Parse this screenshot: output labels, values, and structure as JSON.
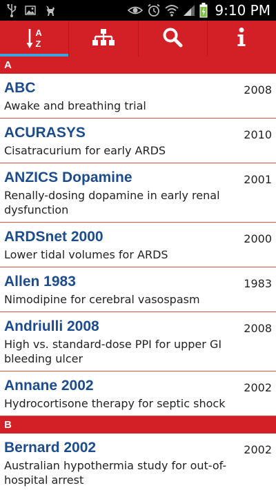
{
  "status_bar": {
    "time": "9:10 PM",
    "icons": [
      "usb-icon",
      "image-icon",
      "cat-icon",
      "eye-icon",
      "alarm-icon",
      "wifi-icon",
      "signal-icon",
      "battery-charging-icon"
    ]
  },
  "tabs": [
    {
      "name": "tab-alphabetical",
      "icon": "sort-az-icon",
      "label_top": "A",
      "label_bottom": "Z",
      "active": true
    },
    {
      "name": "tab-categories",
      "icon": "hierarchy-icon",
      "active": false
    },
    {
      "name": "tab-search",
      "icon": "search-icon",
      "active": false
    },
    {
      "name": "tab-info",
      "icon": "info-icon",
      "active": false
    }
  ],
  "sections": [
    {
      "letter": "A",
      "items": [
        {
          "name": "ABC",
          "year": "2008",
          "desc": "Awake and breathing trial"
        },
        {
          "name": "ACURASYS",
          "year": "2010",
          "desc": "Cisatracurium for early ARDS"
        },
        {
          "name": "ANZICS Dopamine",
          "year": "2001",
          "desc": "Renally-dosing dopamine in early renal dysfunction"
        },
        {
          "name": "ARDSnet 2000",
          "year": "2000",
          "desc": "Lower tidal volumes for ARDS"
        },
        {
          "name": "Allen 1983",
          "year": "1983",
          "desc": "Nimodipine for cerebral vasospasm"
        },
        {
          "name": "Andriulli 2008",
          "year": "2008",
          "desc": "High vs. standard-dose PPI for upper GI bleeding ulcer"
        },
        {
          "name": "Annane 2002",
          "year": "2002",
          "desc": "Hydrocortisone therapy for septic shock"
        }
      ]
    },
    {
      "letter": "B",
      "items": [
        {
          "name": "Bernard 2002",
          "year": "2002",
          "desc": "Australian hypothermia study for out-of-hospital arrest"
        }
      ]
    }
  ],
  "colors": {
    "primary_red": "#d32027",
    "active_tab_indicator": "#3ea0dd",
    "trial_name_blue": "#1d4c8c"
  }
}
